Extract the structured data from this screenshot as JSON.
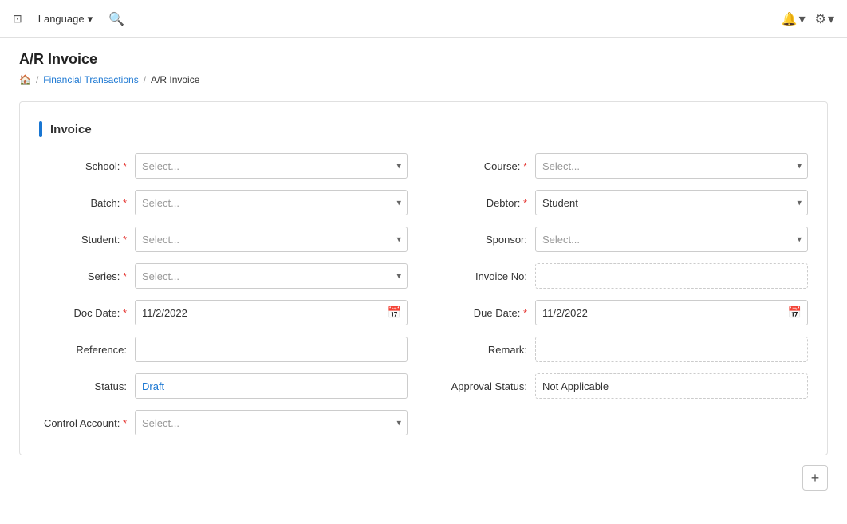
{
  "topnav": {
    "language_label": "Language",
    "chevron_down": "▾",
    "bell_icon": "🔔",
    "gear_icon": "⚙"
  },
  "breadcrumb": {
    "home_icon": "🏠",
    "financial_transactions": "Financial Transactions",
    "current": "A/R Invoice"
  },
  "page_title": "A/R Invoice",
  "section_title": "Invoice",
  "form": {
    "left": [
      {
        "label": "School:",
        "required": true,
        "type": "select",
        "placeholder": "Select...",
        "value": ""
      },
      {
        "label": "Batch:",
        "required": true,
        "type": "select",
        "placeholder": "Select...",
        "value": ""
      },
      {
        "label": "Student:",
        "required": true,
        "type": "select",
        "placeholder": "Select...",
        "value": ""
      },
      {
        "label": "Series:",
        "required": true,
        "type": "select",
        "placeholder": "Select...",
        "value": ""
      },
      {
        "label": "Doc Date:",
        "required": true,
        "type": "date",
        "value": "11/2/2022"
      },
      {
        "label": "Reference:",
        "required": false,
        "type": "text",
        "value": ""
      },
      {
        "label": "Status:",
        "required": false,
        "type": "status",
        "value": "Draft"
      },
      {
        "label": "Control Account:",
        "required": true,
        "type": "select",
        "placeholder": "Select...",
        "value": ""
      }
    ],
    "right": [
      {
        "label": "Course:",
        "required": true,
        "type": "select",
        "placeholder": "Select...",
        "value": ""
      },
      {
        "label": "Debtor:",
        "required": true,
        "type": "select",
        "placeholder": "Select...",
        "value": "Student",
        "has_value": true
      },
      {
        "label": "Sponsor:",
        "required": false,
        "type": "select",
        "placeholder": "Select...",
        "value": ""
      },
      {
        "label": "Invoice No:",
        "required": false,
        "type": "text",
        "value": ""
      },
      {
        "label": "Due Date:",
        "required": true,
        "type": "date",
        "value": "11/2/2022"
      },
      {
        "label": "Remark:",
        "required": false,
        "type": "text",
        "value": ""
      },
      {
        "label": "Approval Status:",
        "required": false,
        "type": "approval",
        "value": "Not Applicable"
      }
    ]
  },
  "add_button_label": "+"
}
